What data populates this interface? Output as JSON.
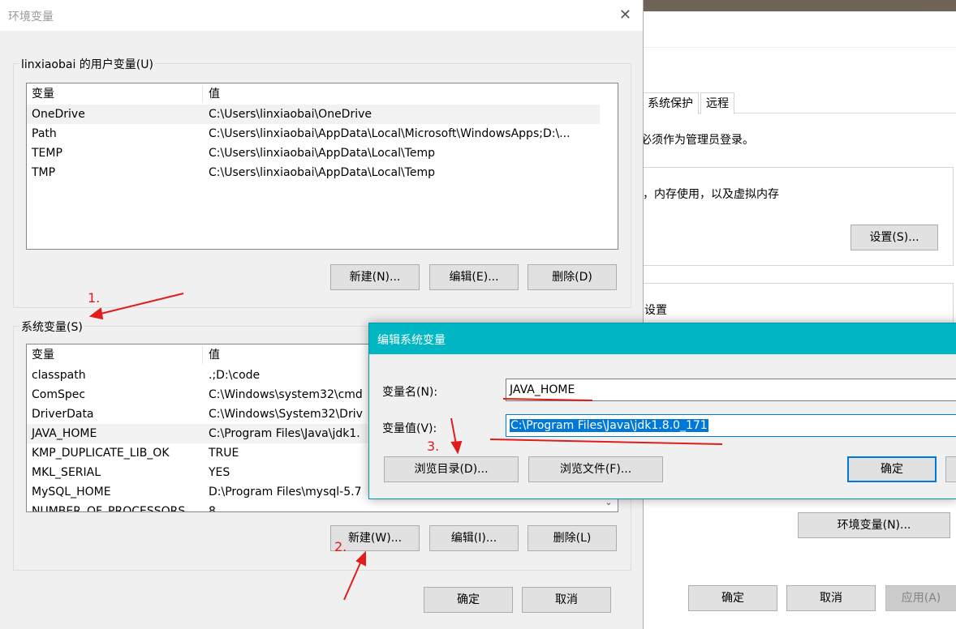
{
  "background_window": {
    "tabs": [
      "系统保护",
      "远程"
    ],
    "admin_notice": "必须作为管理员登录。",
    "perf_text": "，内存使用，以及虚拟内存",
    "settings_button": "设置(S)...",
    "group2_label": "设置",
    "env_button": "环境变量(N)...",
    "ok": "确定",
    "cancel": "取消",
    "apply": "应用(A)"
  },
  "env_dialog": {
    "title": "环境变量",
    "user_section_label": "linxiaobai 的用户变量(U)",
    "columns": [
      "变量",
      "值"
    ],
    "user_vars": [
      {
        "name": "OneDrive",
        "value": "C:\\Users\\linxiaobai\\OneDrive"
      },
      {
        "name": "Path",
        "value": "C:\\Users\\linxiaobai\\AppData\\Local\\Microsoft\\WindowsApps;D:\\..."
      },
      {
        "name": "TEMP",
        "value": "C:\\Users\\linxiaobai\\AppData\\Local\\Temp"
      },
      {
        "name": "TMP",
        "value": "C:\\Users\\linxiaobai\\AppData\\Local\\Temp"
      }
    ],
    "user_buttons": {
      "new": "新建(N)...",
      "edit": "编辑(E)...",
      "delete": "删除(D)"
    },
    "system_section_label": "系统变量(S)",
    "system_vars": [
      {
        "name": "classpath",
        "value": ".;D:\\code"
      },
      {
        "name": "ComSpec",
        "value": "C:\\Windows\\system32\\cmd"
      },
      {
        "name": "DriverData",
        "value": "C:\\Windows\\System32\\Driv"
      },
      {
        "name": "JAVA_HOME",
        "value": "C:\\Program Files\\Java\\jdk1."
      },
      {
        "name": "KMP_DUPLICATE_LIB_OK",
        "value": "TRUE"
      },
      {
        "name": "MKL_SERIAL",
        "value": "YES"
      },
      {
        "name": "MySQL_HOME",
        "value": "D:\\Program Files\\mysql-5.7"
      },
      {
        "name": "NUMBER_OF_PROCESSORS",
        "value": "8"
      }
    ],
    "system_buttons": {
      "new": "新建(W)...",
      "edit": "编辑(I)...",
      "delete": "删除(L)"
    },
    "ok": "确定",
    "cancel": "取消"
  },
  "edit_dialog": {
    "title": "编辑系统变量",
    "name_label": "变量名(N):",
    "name_value": "JAVA_HOME",
    "value_label": "变量值(V):",
    "value_value": "C:\\Program Files\\Java\\jdk1.8.0_171",
    "browse_dir": "浏览目录(D)...",
    "browse_file": "浏览文件(F)...",
    "ok": "确定"
  },
  "annotations": [
    "1.",
    "2.",
    "3."
  ],
  "colors": {
    "accent": "#0078d7",
    "titlebar": "#00b7c3",
    "annotation": "#e21b1b"
  }
}
